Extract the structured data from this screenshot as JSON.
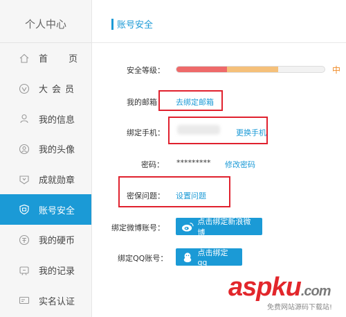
{
  "sidebar": {
    "title": "个人中心",
    "items": [
      {
        "label": "首  页",
        "icon": "home-icon"
      },
      {
        "label": "大会员",
        "icon": "vip-icon"
      },
      {
        "label": "我的信息",
        "icon": "user-icon"
      },
      {
        "label": "我的头像",
        "icon": "avatar-icon"
      },
      {
        "label": "成就勋章",
        "icon": "medal-icon"
      },
      {
        "label": "账号安全",
        "icon": "shield-icon",
        "active": true
      },
      {
        "label": "我的硬币",
        "icon": "coin-icon"
      },
      {
        "label": "我的记录",
        "icon": "record-icon"
      },
      {
        "label": "实名认证",
        "icon": "id-card-icon"
      }
    ]
  },
  "main": {
    "title": "账号安全",
    "security": {
      "label": "安全等级：",
      "level": "中",
      "level_fraction_red": 0.34,
      "level_fraction_orange": 0.34
    },
    "email": {
      "label": "我的邮箱：",
      "link": "去绑定邮箱"
    },
    "phone": {
      "label": "绑定手机：",
      "link": "更换手机"
    },
    "password": {
      "label": "密码：",
      "value": "*********",
      "link": "修改密码"
    },
    "question": {
      "label": "密保问题：",
      "link": "设置问题"
    },
    "weibo": {
      "label": "绑定微博账号：",
      "button": "点击绑定新浪微博"
    },
    "qq": {
      "label": "绑定QQ账号：",
      "button": "点击绑定qq"
    }
  },
  "watermark": {
    "brand": "aspku",
    "domain": ".com",
    "tagline": "免费网站源码下载站!"
  },
  "colors": {
    "accent": "#1b9ad6",
    "annotation": "#e0212e",
    "security_red": "#ee6a6a",
    "security_orange": "#f5c07a",
    "security_level_text": "#f08a24"
  }
}
